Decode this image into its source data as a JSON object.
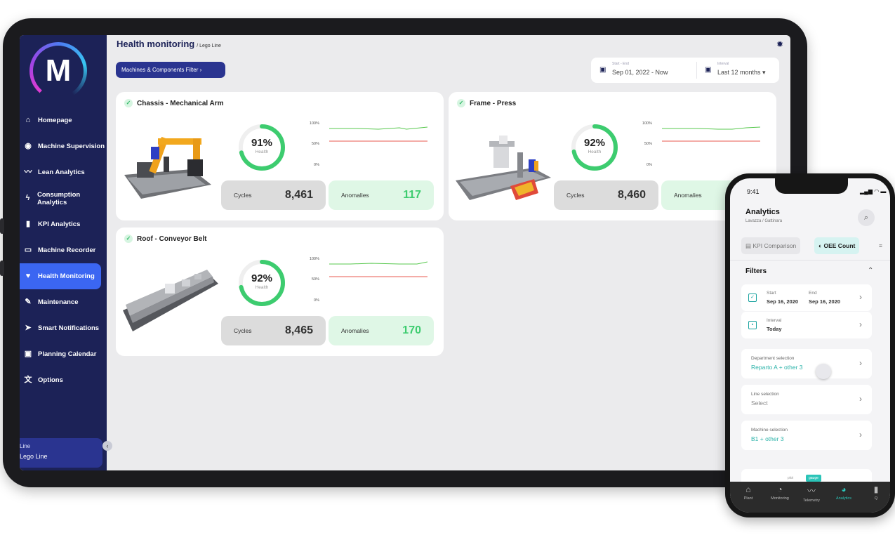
{
  "sidebar": {
    "logo_letter": "M",
    "items": [
      {
        "label": "Homepage",
        "icon": "home-icon",
        "glyph": "⌂"
      },
      {
        "label": "Machine Supervision",
        "icon": "eye-icon",
        "glyph": "◉"
      },
      {
        "label": "Lean Analytics",
        "icon": "trend-icon",
        "glyph": "〰"
      },
      {
        "label": "Consumption Analytics",
        "icon": "bolt-icon",
        "glyph": "ϟ"
      },
      {
        "label": "KPI Analytics",
        "icon": "bar-chart-icon",
        "glyph": "▮"
      },
      {
        "label": "Machine Recorder",
        "icon": "recorder-icon",
        "glyph": "▭"
      },
      {
        "label": "Health Monitoring",
        "icon": "heart-pulse-icon",
        "glyph": "♥"
      },
      {
        "label": "Maintenance",
        "icon": "wrench-icon",
        "glyph": "✎"
      },
      {
        "label": "Smart Notifications",
        "icon": "send-icon",
        "glyph": "➤"
      },
      {
        "label": "Planning Calendar",
        "icon": "calendar-icon",
        "glyph": "▣"
      },
      {
        "label": "Options",
        "icon": "translate-icon",
        "glyph": "文"
      }
    ],
    "active_index": 6,
    "line_label": "Line",
    "line_value": "Lego Line",
    "collapse_glyph": "‹"
  },
  "header": {
    "title": "Health monitoring",
    "subtitle": "/ Lego Line",
    "filter_button": "Machines & Components Filter  ›",
    "date_label": "Start - End",
    "date_value": "Sep 01, 2022 - Now",
    "interval_label": "Interval",
    "interval_value": "Last 12 months ▾"
  },
  "cards": [
    {
      "title": "Chassis - Mechanical Arm",
      "health": 91,
      "health_text": "91%",
      "health_label": "Health",
      "cycles_label": "Cycles",
      "cycles": "8,461",
      "anomalies_label": "Anomalies",
      "anomalies": "117"
    },
    {
      "title": "Frame - Press",
      "health": 92,
      "health_text": "92%",
      "health_label": "Health",
      "cycles_label": "Cycles",
      "cycles": "8,460",
      "anomalies_label": "Anomalies",
      "anomalies": ""
    },
    {
      "title": "Roof - Conveyor Belt",
      "health": 92,
      "health_text": "92%",
      "health_label": "Health",
      "cycles_label": "Cycles",
      "cycles": "8,465",
      "anomalies_label": "Anomalies",
      "anomalies": "170"
    }
  ],
  "mini_chart_ticks": [
    "100%",
    "50%",
    "0%"
  ],
  "colors": {
    "sidebar": "#1c2257",
    "active": "#3b66f2",
    "health_green": "#3dcc6f",
    "threshold_red": "#e8584f",
    "teal": "#2bb3a9"
  },
  "phone": {
    "time": "9:41",
    "status": "▂▄▆ ◠ ▬",
    "title": "Analytics",
    "subtitle": "Lavazza / Gattinara",
    "tabs": [
      "▤ KPI Comparison",
      "◐ OEE Count",
      "≡"
    ],
    "filters_title": "Filters",
    "start_label": "Start",
    "start_value": "Sep 16, 2020",
    "end_label": "End",
    "end_value": "Sep 16, 2020",
    "interval_label": "Interval",
    "interval_value": "Today",
    "department_label": "Department selection",
    "department_value": "Reparto A + other 3",
    "line_label": "Line selection",
    "line_value": "Select",
    "machine_label": "Machine selection",
    "machine_value": "B1 + other 3",
    "mini_tabs": [
      "plot",
      "gauge"
    ],
    "tabbar": [
      {
        "label": "Plant",
        "glyph": "⌂"
      },
      {
        "label": "Monitoring",
        "glyph": "◔"
      },
      {
        "label": "Telemetry",
        "glyph": "〰"
      },
      {
        "label": "Analytics",
        "glyph": "◕"
      },
      {
        "label": "Q",
        "glyph": "▮"
      }
    ]
  }
}
